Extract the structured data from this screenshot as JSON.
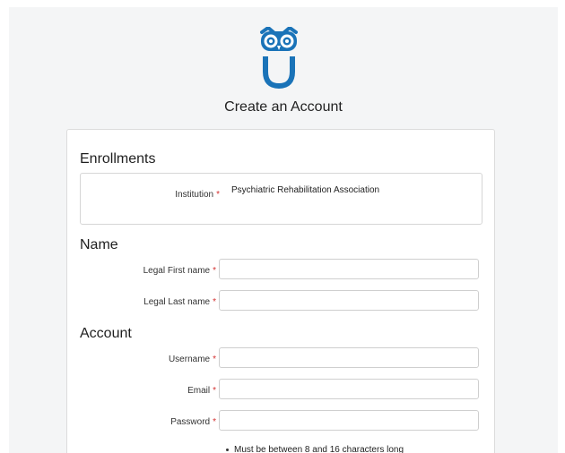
{
  "header": {
    "title": "Create an Account",
    "logo_icon": "owl-u-logo-icon",
    "brand_color": "#1a73b8"
  },
  "sections": {
    "enrollments": {
      "heading": "Enrollments",
      "institution_label": "Institution",
      "institution_value": "Psychiatric Rehabilitation Association"
    },
    "name": {
      "heading": "Name",
      "first_label": "Legal First name",
      "first_value": "",
      "last_label": "Legal Last name",
      "last_value": ""
    },
    "account": {
      "heading": "Account",
      "username_label": "Username",
      "username_value": "",
      "email_label": "Email",
      "email_value": "",
      "password_label": "Password",
      "password_value": "",
      "password_hint": "Must be between 8 and 16 characters long"
    }
  },
  "required_marker": "*",
  "colors": {
    "required": "#d32f2f",
    "background": "#f4f5f6"
  }
}
